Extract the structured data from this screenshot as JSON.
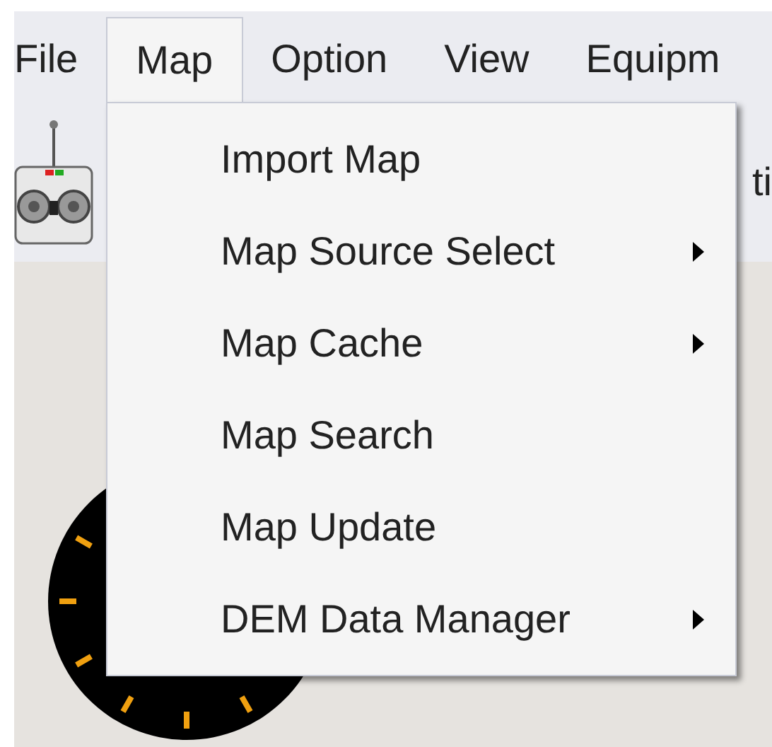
{
  "menu_bar": [
    {
      "label": "File",
      "selected": false
    },
    {
      "label": "Map",
      "selected": true
    },
    {
      "label": "Option",
      "selected": false
    },
    {
      "label": "View",
      "selected": false
    },
    {
      "label": "Equipm",
      "selected": false
    }
  ],
  "toolbar": {
    "cut_label": "ti"
  },
  "dropdown": [
    {
      "label": "Import Map",
      "submenu": false
    },
    {
      "label": "Map Source Select",
      "submenu": true
    },
    {
      "label": "Map Cache",
      "submenu": true
    },
    {
      "label": "Map Search",
      "submenu": false
    },
    {
      "label": "Map Update",
      "submenu": false
    },
    {
      "label": "DEM Data Manager",
      "submenu": true
    }
  ]
}
